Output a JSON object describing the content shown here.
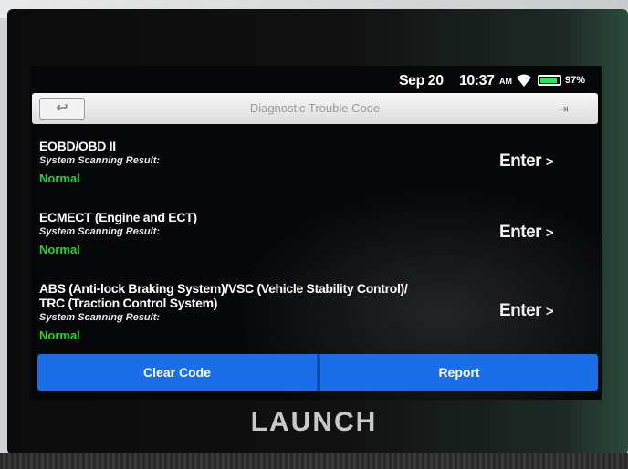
{
  "status": {
    "date": "Sep 20",
    "time": "10:37",
    "time_suffix": "AM",
    "battery": "97%"
  },
  "header": {
    "title": "Diagnostic Trouble Code",
    "back_icon": "back-arrow-icon",
    "exit_icon": "exit-icon"
  },
  "systems": [
    {
      "name": "EOBD/OBD II",
      "subtitle": "System Scanning Result:",
      "status": "Normal",
      "action": "Enter"
    },
    {
      "name": "ECMECT (Engine and ECT)",
      "subtitle": "System Scanning Result:",
      "status": "Normal",
      "action": "Enter"
    },
    {
      "name_line1": "ABS (Anti-lock Braking System)/VSC (Vehicle Stability Control)/",
      "name_line2": "TRC (Traction Control System)",
      "subtitle": "System Scanning Result:",
      "status": "Normal",
      "action": "Enter"
    }
  ],
  "actions": {
    "clear_code": "Clear Code",
    "report": "Report"
  },
  "brand": "LAUNCH",
  "colors": {
    "status_normal": "#1fd42c",
    "button_blue": "#1a6fe8"
  }
}
